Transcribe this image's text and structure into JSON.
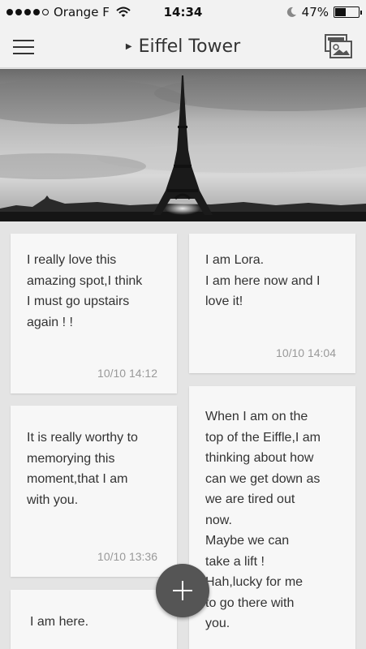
{
  "status_bar": {
    "carrier": "Orange F",
    "time": "14:34",
    "battery_text": "47%",
    "battery_level": 0.47,
    "signal_icon": "signal-dots-icon",
    "wifi_icon": "wifi-icon",
    "moon_icon": "moon-icon"
  },
  "nav": {
    "title": "Eiffel Tower",
    "menu_icon": "hamburger-menu-icon",
    "gallery_icon": "photo-gallery-icon"
  },
  "hero": {
    "image": "eiffel-tower-photo",
    "style": "black-and-white"
  },
  "cards": [
    {
      "text": "I really love this\namazing spot,I think\nI must go upstairs\nagain ! !",
      "time": "10/10 14:12"
    },
    {
      "text": "I am Lora.\nI am here now and I\nlove it!",
      "time": "10/10 14:04"
    },
    {
      "text": "It is really worthy to\nmemorying this\nmoment,that I am\nwith you.",
      "time": "10/10 13:36"
    },
    {
      "text": "When I am on the\ntop of the Eiffle,I am\nthinking about how\ncan we get down as\nwe are tired out\nnow.\nMaybe we can\ntake a lift !\nHah,lucky for me\nto go there with\nyou.",
      "time": ""
    },
    {
      "text": "I am here.",
      "time": ""
    }
  ],
  "fab": {
    "icon": "plus-icon"
  },
  "colors": {
    "background": "#e4e4e4",
    "card": "#f7f7f7",
    "fab": "#555555",
    "timestamp": "#999999"
  }
}
